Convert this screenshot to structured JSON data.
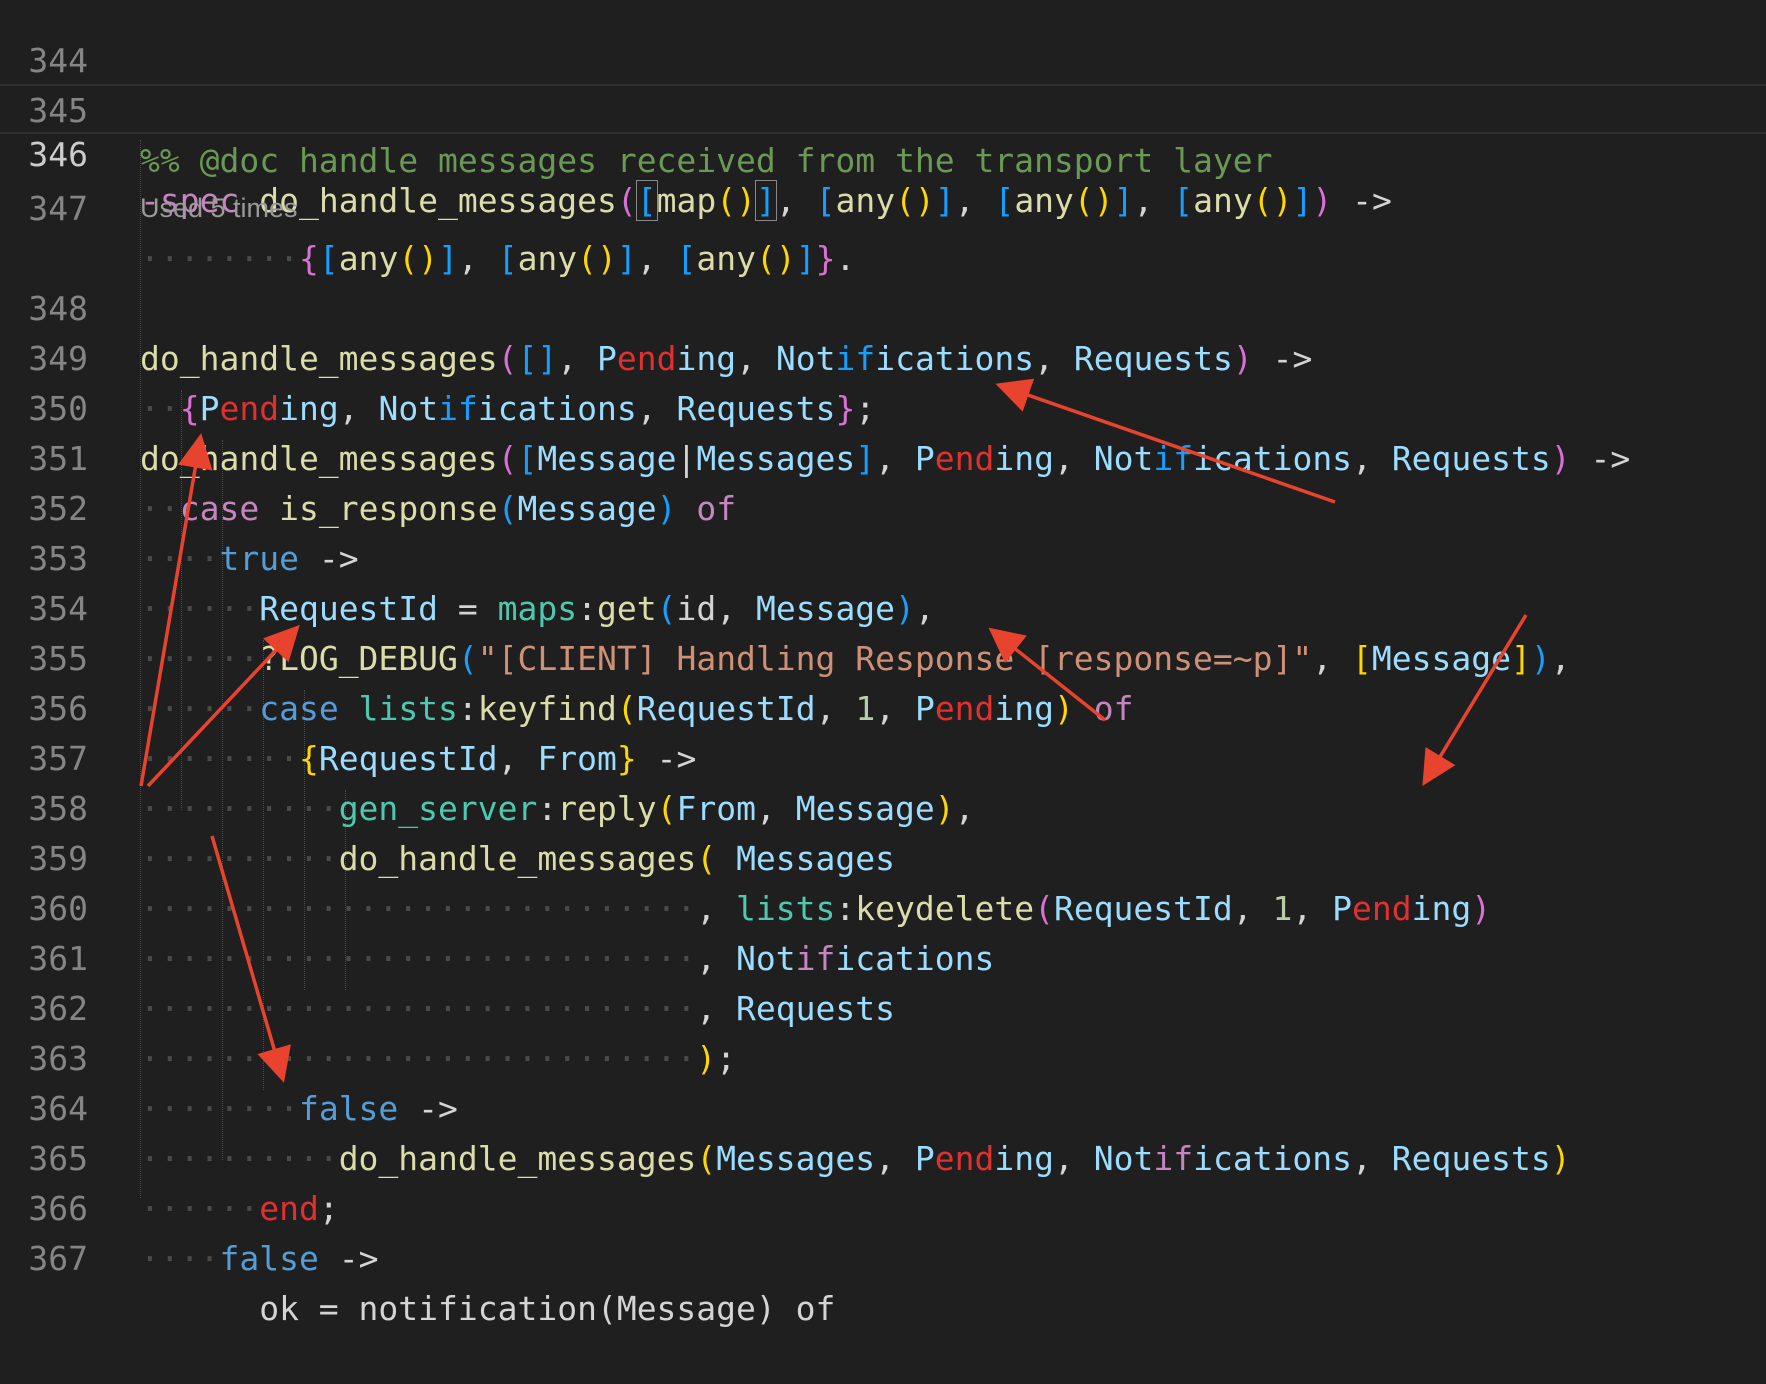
{
  "codelens": "Used 5 times",
  "colors": {
    "arrow": "#e8432e",
    "background": "#1f1f1f"
  },
  "lines": [
    {
      "num": "344",
      "text": ""
    },
    {
      "num": "345",
      "text": "%% @doc handle messages received from the transport layer"
    },
    {
      "num": "346",
      "text": "-spec do_handle_messages([map()], [any()], [any()], [any()]) ->",
      "current": true
    },
    {
      "num": "347",
      "text": "        {[any()], [any()], [any()]}."
    },
    {
      "num": "348",
      "text": "do_handle_messages([], Pending, Notifications, Requests) ->"
    },
    {
      "num": "349",
      "text": "  {Pending, Notifications, Requests};"
    },
    {
      "num": "350",
      "text": "do_handle_messages([Message|Messages], Pending, Notifications, Requests) ->"
    },
    {
      "num": "351",
      "text": "  case is_response(Message) of"
    },
    {
      "num": "352",
      "text": "    true ->"
    },
    {
      "num": "353",
      "text": "      RequestId = maps:get(id, Message),"
    },
    {
      "num": "354",
      "text": "      ?LOG_DEBUG(\"[CLIENT] Handling Response [response=~p]\", [Message]),"
    },
    {
      "num": "355",
      "text": "      case lists:keyfind(RequestId, 1, Pending) of"
    },
    {
      "num": "356",
      "text": "        {RequestId, From} ->"
    },
    {
      "num": "357",
      "text": "          gen_server:reply(From, Message),"
    },
    {
      "num": "358",
      "text": "          do_handle_messages( Messages"
    },
    {
      "num": "359",
      "text": "                            , lists:keydelete(RequestId, 1, Pending)"
    },
    {
      "num": "360",
      "text": "                            , Notifications"
    },
    {
      "num": "361",
      "text": "                            , Requests"
    },
    {
      "num": "362",
      "text": "                            );"
    },
    {
      "num": "363",
      "text": "        false ->"
    },
    {
      "num": "364",
      "text": "          do_handle_messages(Messages, Pending, Notifications, Requests)"
    },
    {
      "num": "365",
      "text": "      end;"
    },
    {
      "num": "366",
      "text": "    false ->"
    },
    {
      "num": "367",
      "text": "      ok = notification(Message) of"
    }
  ]
}
